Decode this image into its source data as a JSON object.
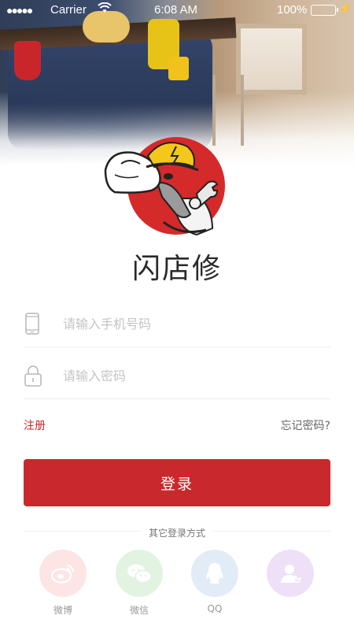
{
  "status_bar": {
    "carrier": "Carrier",
    "time": "6:08 AM",
    "battery_percent": "100%"
  },
  "app": {
    "name": "闪店修"
  },
  "form": {
    "phone_placeholder": "请输入手机号码",
    "phone_value": "",
    "password_placeholder": "请输入密码",
    "password_value": ""
  },
  "links": {
    "register": "注册",
    "forgot_password": "忘记密码?"
  },
  "login_button": "登录",
  "other_login": {
    "title": "其它登录方式",
    "providers": [
      {
        "label": "微博",
        "icon": "weibo-icon",
        "color": "#fde5e5"
      },
      {
        "label": "微信",
        "icon": "wechat-icon",
        "color": "#e2f4e1"
      },
      {
        "label": "QQ",
        "icon": "qq-icon",
        "color": "#e1ecf7"
      },
      {
        "label": "",
        "icon": "user-icon",
        "color": "#eee0f7"
      }
    ]
  },
  "colors": {
    "accent": "#c9292c",
    "battery": "#44d62c"
  }
}
